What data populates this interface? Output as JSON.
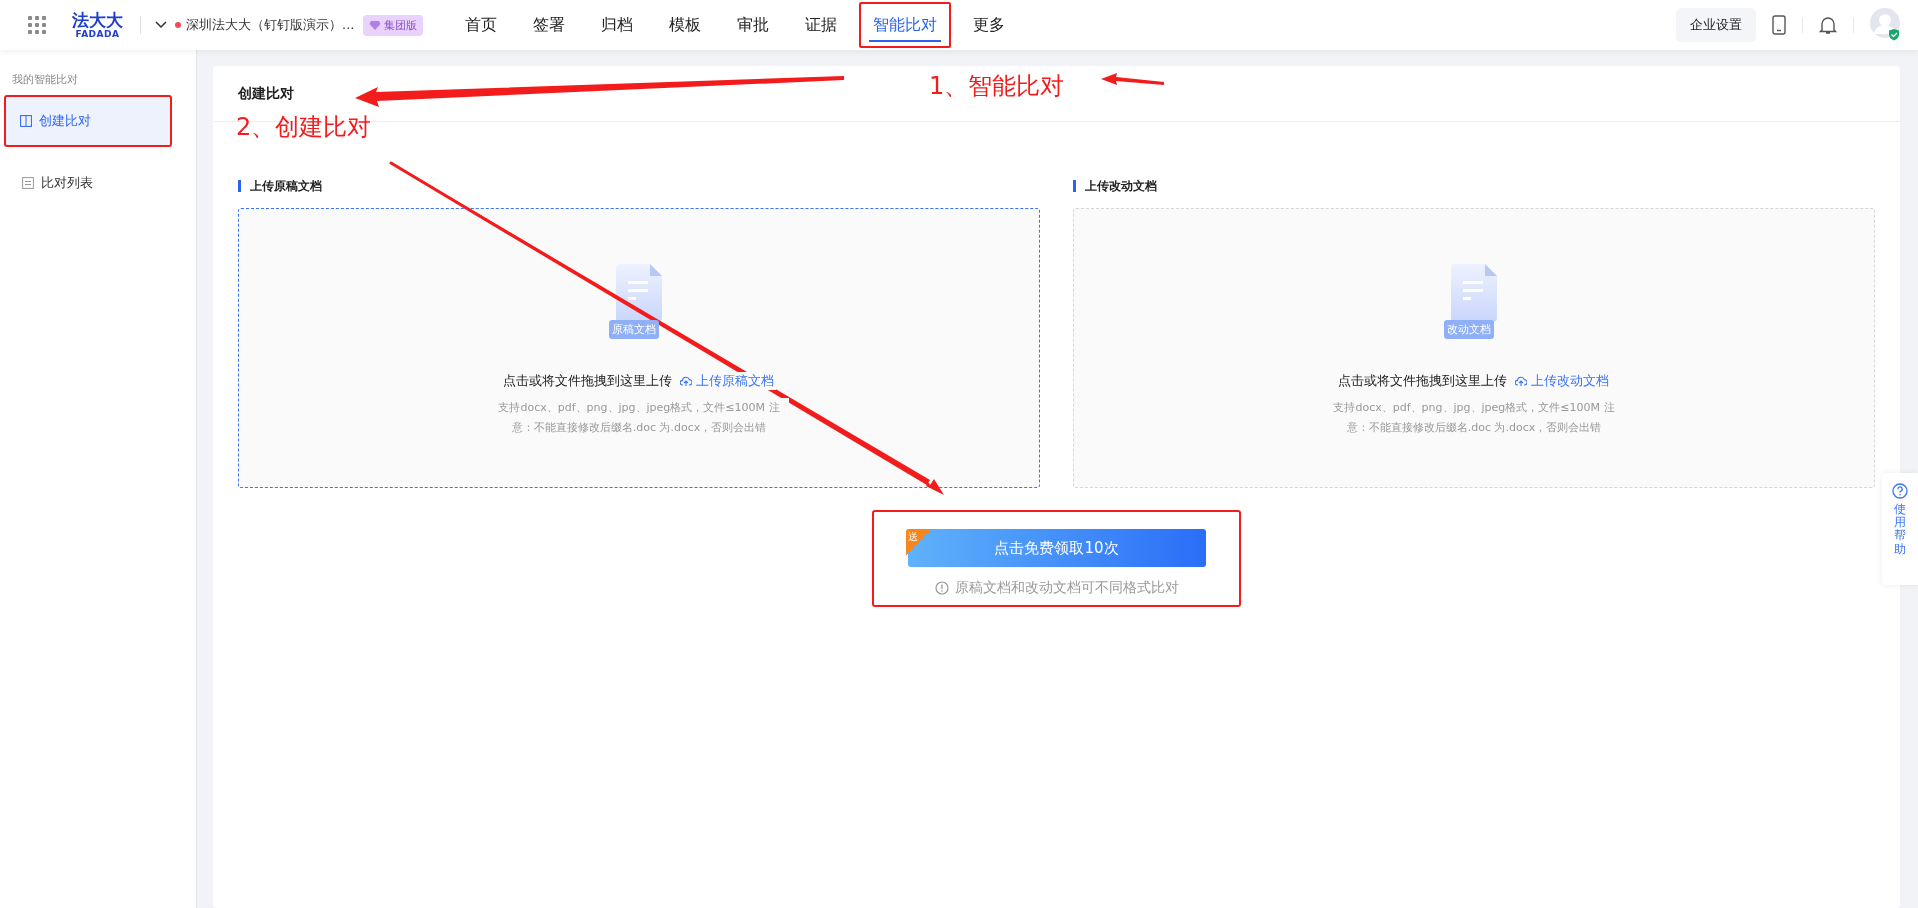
{
  "header": {
    "logo_cn": "法大大",
    "logo_en": "FADADA",
    "company": "深圳法大大（钉钉版演示）...",
    "edition": "集团版",
    "nav": [
      {
        "label": "首页",
        "selected": false,
        "highlighted": false
      },
      {
        "label": "签署",
        "selected": false,
        "highlighted": false
      },
      {
        "label": "归档",
        "selected": false,
        "highlighted": false
      },
      {
        "label": "模板",
        "selected": false,
        "highlighted": false
      },
      {
        "label": "审批",
        "selected": false,
        "highlighted": false
      },
      {
        "label": "证据",
        "selected": false,
        "highlighted": false
      },
      {
        "label": "智能比对",
        "selected": true,
        "highlighted": true
      },
      {
        "label": "更多",
        "selected": false,
        "highlighted": false
      }
    ],
    "settings_button": "企业设置"
  },
  "sidebar": {
    "heading": "我的智能比对",
    "items": [
      {
        "label": "创建比对",
        "selected": true,
        "highlighted": true
      },
      {
        "label": "比对列表",
        "selected": false,
        "highlighted": false
      }
    ]
  },
  "page_title": "创建比对",
  "uploads": [
    {
      "heading": "上传原稿文档",
      "badge": "原稿文档",
      "prompt": "点击或将文件拖拽到这里上传",
      "link": "上传原稿文档",
      "hint": "支持docx、pdf、png、jpg、jpeg格式，文件≤100M 注意：不能直接修改后缀名.doc 为.docx，否则会出错",
      "active": true
    },
    {
      "heading": "上传改动文档",
      "badge": "改动文档",
      "prompt": "点击或将文件拖拽到这里上传",
      "link": "上传改动文档",
      "hint": "支持docx、pdf、png、jpg、jpeg格式，文件≤100M 注意：不能直接修改后缀名.doc 为.docx，否则会出错",
      "active": false
    }
  ],
  "action": {
    "corner_badge": "送",
    "button": "点击免费领取10次",
    "note": "原稿文档和改动文档可不同格式比对",
    "highlighted": true
  },
  "help": "使用帮助",
  "annotations": [
    "1、智能比对",
    "2、创建比对"
  ]
}
